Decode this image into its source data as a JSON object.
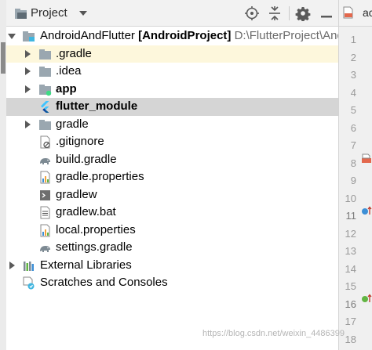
{
  "panel": {
    "title": "Project",
    "icons": {
      "project": "project-view-icon",
      "dropdown": "chevron-down-icon",
      "locate": "locate-target-icon",
      "collapse": "collapse-all-icon",
      "settings": "gear-icon",
      "hide": "minimize-icon"
    }
  },
  "tree": {
    "root": {
      "name": "AndroidAndFlutter",
      "module": "[AndroidProject]",
      "path": "D:\\FlutterProject\\And"
    },
    "items": [
      {
        "label": ".gradle",
        "icon": "folder-icon"
      },
      {
        "label": ".idea",
        "icon": "folder-icon"
      },
      {
        "label": "app",
        "icon": "module-folder-icon"
      },
      {
        "label": "flutter_module",
        "icon": "flutter-icon"
      },
      {
        "label": "gradle",
        "icon": "folder-icon"
      },
      {
        "label": ".gitignore",
        "icon": "gitignore-file-icon"
      },
      {
        "label": "build.gradle",
        "icon": "gradle-elephant-icon"
      },
      {
        "label": "gradle.properties",
        "icon": "properties-file-icon"
      },
      {
        "label": "gradlew",
        "icon": "shell-script-icon"
      },
      {
        "label": "gradlew.bat",
        "icon": "text-file-icon"
      },
      {
        "label": "local.properties",
        "icon": "properties-file-icon"
      },
      {
        "label": "settings.gradle",
        "icon": "gradle-elephant-icon"
      }
    ],
    "external_libraries": "External Libraries",
    "scratches": "Scratches and Consoles"
  },
  "editor": {
    "tab_label": "ac",
    "line_numbers": [
      "1",
      "2",
      "3",
      "4",
      "5",
      "6",
      "7",
      "8",
      "9",
      "10",
      "11",
      "12",
      "13",
      "14",
      "15",
      "16",
      "17",
      "18"
    ]
  },
  "watermark": "https://blog.csdn.net/weixin_4486399",
  "colors": {
    "selected_row": "#d5d5d5",
    "highlight_row": "#fdf7dc",
    "folder": "#9aa7b0",
    "flutter": "#3fb6f4"
  }
}
